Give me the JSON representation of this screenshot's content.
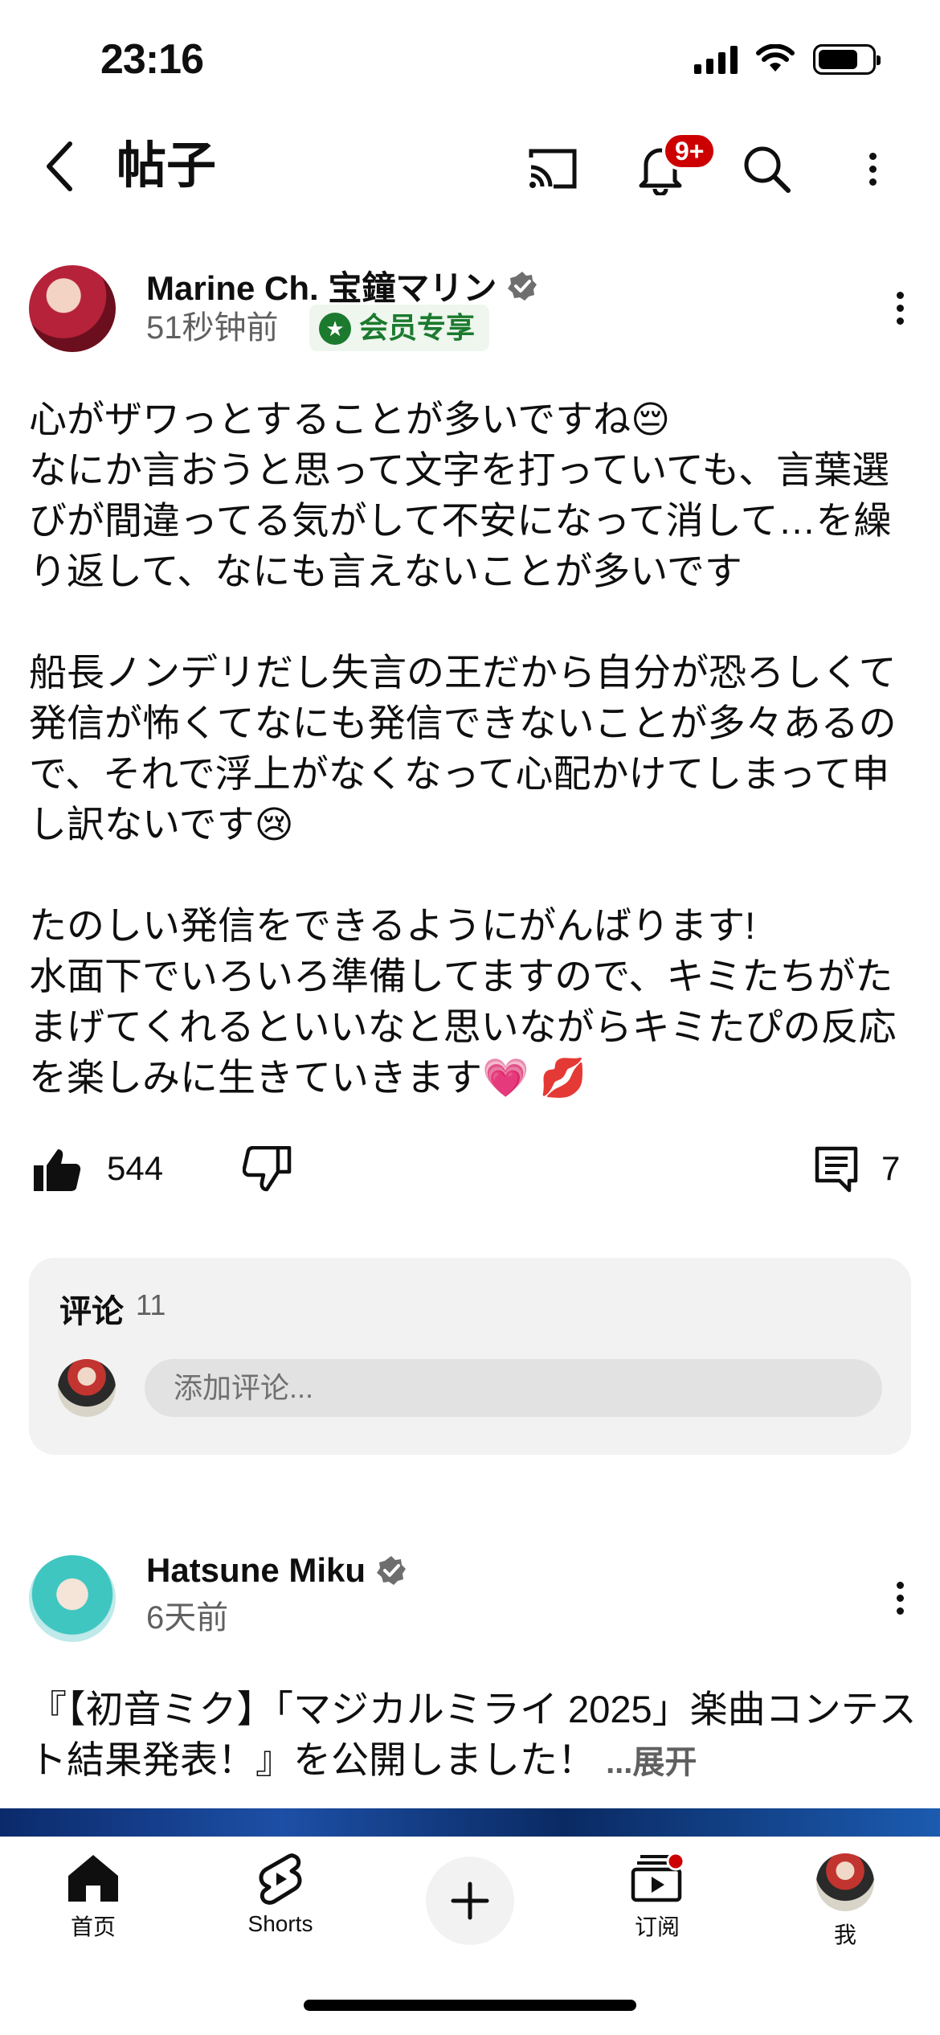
{
  "status_bar": {
    "time": "23:16"
  },
  "header": {
    "title": "帖子",
    "notification_badge": "9+"
  },
  "post": {
    "author": "Marine Ch. 宝鐘マリン",
    "time_ago": "51秒钟前",
    "member_badge": "会员专享",
    "paragraphs": [
      "心がザワっとすることが多いですね😔\nなにか言おうと思って文字を打っていても、言葉選びが間違ってる気がして不安になって消して…を繰り返して、なにも言えないことが多いです",
      "船長ノンデリだし失言の王だから自分が恐ろしくて発信が怖くてなにも発信できないことが多々あるので、それで浮上がなくなって心配かけてしまって申し訳ないです😢",
      "たのしい発信をできるようにがんばります!\n水面下でいろいろ準備してますので、キミたちがたまげてくれるといいなと思いながらキミたぴの反応を楽しみに生きていきます💗 💋"
    ],
    "likes": "544",
    "comments_count": "7"
  },
  "comments_section": {
    "title": "评论",
    "count": "11",
    "input_placeholder": "添加评论..."
  },
  "post2": {
    "author": "Hatsune Miku",
    "time_ago": "6天前",
    "text": "『【初音ミク】「マジカルミライ 2025」楽曲コンテスト結果発表！』を公開しました！",
    "more_label": "...展开"
  },
  "bottom_nav": {
    "home": "首页",
    "shorts": "Shorts",
    "subscriptions": "订阅",
    "me": "我"
  },
  "colors": {
    "accent_red": "#cc0000",
    "member_green": "#1b7a2e",
    "secondary_text": "#606060"
  }
}
